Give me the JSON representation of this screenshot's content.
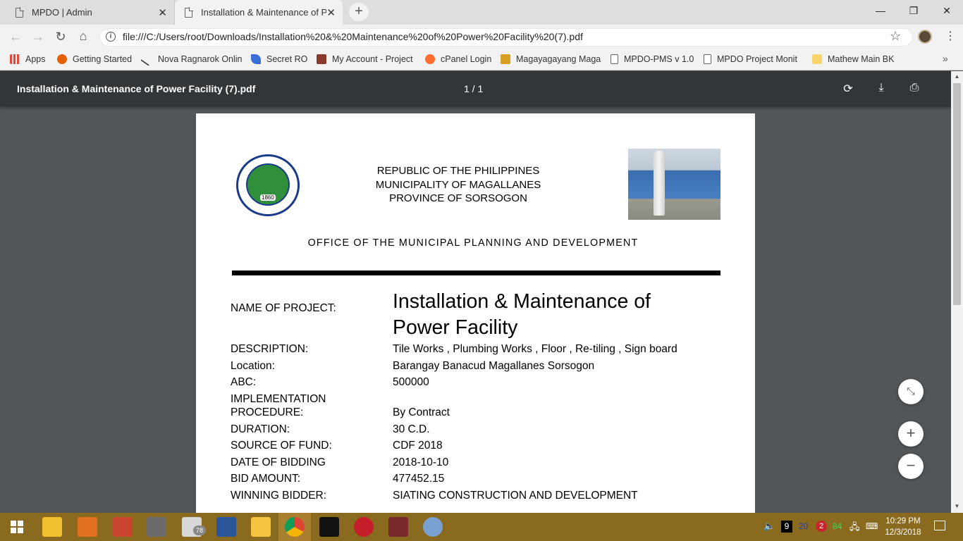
{
  "tabs": [
    {
      "label": "MPDO | Admin",
      "active": false
    },
    {
      "label": "Installation & Maintenance of Po",
      "active": true
    }
  ],
  "address": {
    "url": "file:///C:/Users/root/Downloads/Installation%20&%20Maintenance%20of%20Power%20Facility%20(7).pdf"
  },
  "bookmarks": [
    {
      "label": "Apps",
      "icon": "apps-grid-icon",
      "color": "#e8453c"
    },
    {
      "label": "Getting Started",
      "icon": "firefox-icon",
      "color": "#e66000"
    },
    {
      "label": "Nova Ragnarok Onlin",
      "icon": "sword-icon",
      "color": "#444444"
    },
    {
      "label": "Secret RO",
      "icon": "feather-icon",
      "color": "#3b6fd8"
    },
    {
      "label": "My Account - Project",
      "icon": "game-icon",
      "color": "#8a3a2a"
    },
    {
      "label": "cPanel Login",
      "icon": "cpanel-icon",
      "color": "#ff6c2c"
    },
    {
      "label": "Magayagayang Maga",
      "icon": "festival-icon",
      "color": "#d8a020"
    },
    {
      "label": "MPDO-PMS v 1.0",
      "icon": "page-icon",
      "color": "#ffffff"
    },
    {
      "label": "MPDO Project Monit",
      "icon": "page-icon",
      "color": "#ffffff"
    },
    {
      "label": "Mathew Main BK",
      "icon": "folder-icon",
      "color": "#f5d76e"
    }
  ],
  "pdf": {
    "title": "Installation & Maintenance of Power Facility (7).pdf",
    "page_indicator": "1  /  1"
  },
  "document": {
    "header": [
      "REPUBLIC OF THE PHILIPPINES",
      "MUNICIPALITY OF MAGALLANES",
      "PROVINCE OF SORSOGON"
    ],
    "seal_year": "1860",
    "office": "OFFICE OF THE MUNICIPAL PLANNING AND DEVELOPMENT",
    "project_label": "NAME OF PROJECT:",
    "project_name": "Installation & Maintenance of Power Facility",
    "fields": [
      {
        "label": "DESCRIPTION:",
        "value": "Tile Works , Plumbing Works , Floor , Re-tiling , Sign board"
      },
      {
        "label": "Location:",
        "value": "Barangay Banacud Magallanes Sorsogon"
      },
      {
        "label": "ABC:",
        "value": "500000"
      },
      {
        "label": "IMPLEMENTATION",
        "value": ""
      },
      {
        "label": "PROCEDURE:",
        "value": "By Contract"
      },
      {
        "label": "DURATION:",
        "value": "30 C.D."
      },
      {
        "label": "SOURCE OF FUND:",
        "value": "CDF 2018"
      },
      {
        "label": "DATE OF BIDDING",
        "value": "2018-10-10"
      },
      {
        "label": "BID AMOUNT:",
        "value": "477452.15"
      },
      {
        "label": "WINNING BIDDER:",
        "value": "SIATING CONSTRUCTION AND DEVELOPMENT"
      }
    ]
  },
  "taskbar": {
    "mail_badge": "78",
    "tray_numbers": [
      "9",
      "20",
      "2",
      "84"
    ],
    "time": "10:29 PM",
    "date": "12/3/2018"
  }
}
